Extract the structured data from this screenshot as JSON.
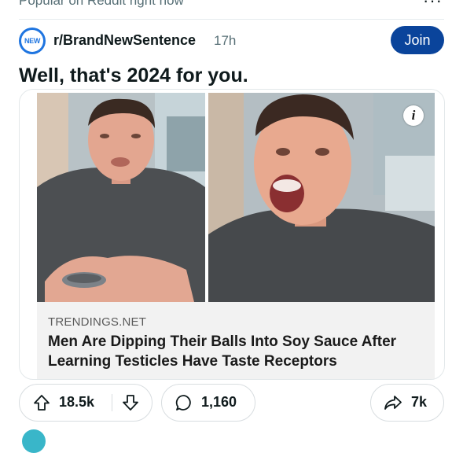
{
  "feed": {
    "context_label": "Popular on Reddit right now",
    "more_label": "···"
  },
  "post": {
    "subreddit": "r/BrandNewSentence",
    "time": "17h",
    "join_label": "Join",
    "community_badge": "NEW",
    "title": "Well, that's 2024 for you.",
    "link": {
      "domain": "TRENDINGS.NET",
      "headline": "Men Are Dipping Their Balls Into Soy Sauce After Learning Testicles Have Taste Receptors",
      "info_label": "i"
    },
    "stats": {
      "score": "18.5k",
      "comments": "1,160",
      "shares": "7k"
    }
  },
  "icons": {
    "upvote": "upvote-arrow-icon",
    "downvote": "downvote-arrow-icon",
    "comment": "comment-bubble-icon",
    "share": "share-arrow-icon",
    "info": "info-icon"
  },
  "colors": {
    "join_button": "#0a449b",
    "subreddit_icon": "#1f75e0",
    "meta_text": "#576f76"
  }
}
